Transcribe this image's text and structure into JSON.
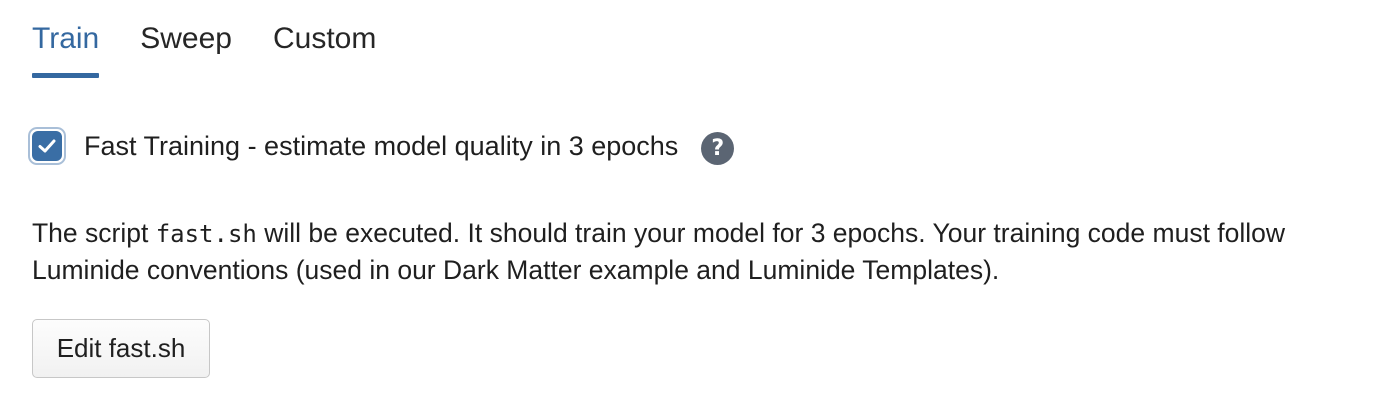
{
  "tabs": [
    {
      "label": "Train",
      "active": true
    },
    {
      "label": "Sweep",
      "active": false
    },
    {
      "label": "Custom",
      "active": false
    }
  ],
  "fast_training": {
    "checked": true,
    "label": "Fast Training - estimate model quality in 3 epochs",
    "help_icon": "question-circle-icon",
    "help_glyph": "?"
  },
  "description": {
    "prefix": "The script ",
    "script_name": "fast.sh",
    "suffix": " will be executed. It should train your model for 3 epochs. Your training code must follow Luminide conventions (used in our Dark Matter example and Luminide Templates)."
  },
  "edit_button": {
    "label": "Edit fast.sh"
  },
  "colors": {
    "accent": "#3468a0",
    "checkbox_fill": "#3a6ea5",
    "checkbox_ring": "#a9bfd8",
    "help_icon_bg": "#5b6573"
  }
}
